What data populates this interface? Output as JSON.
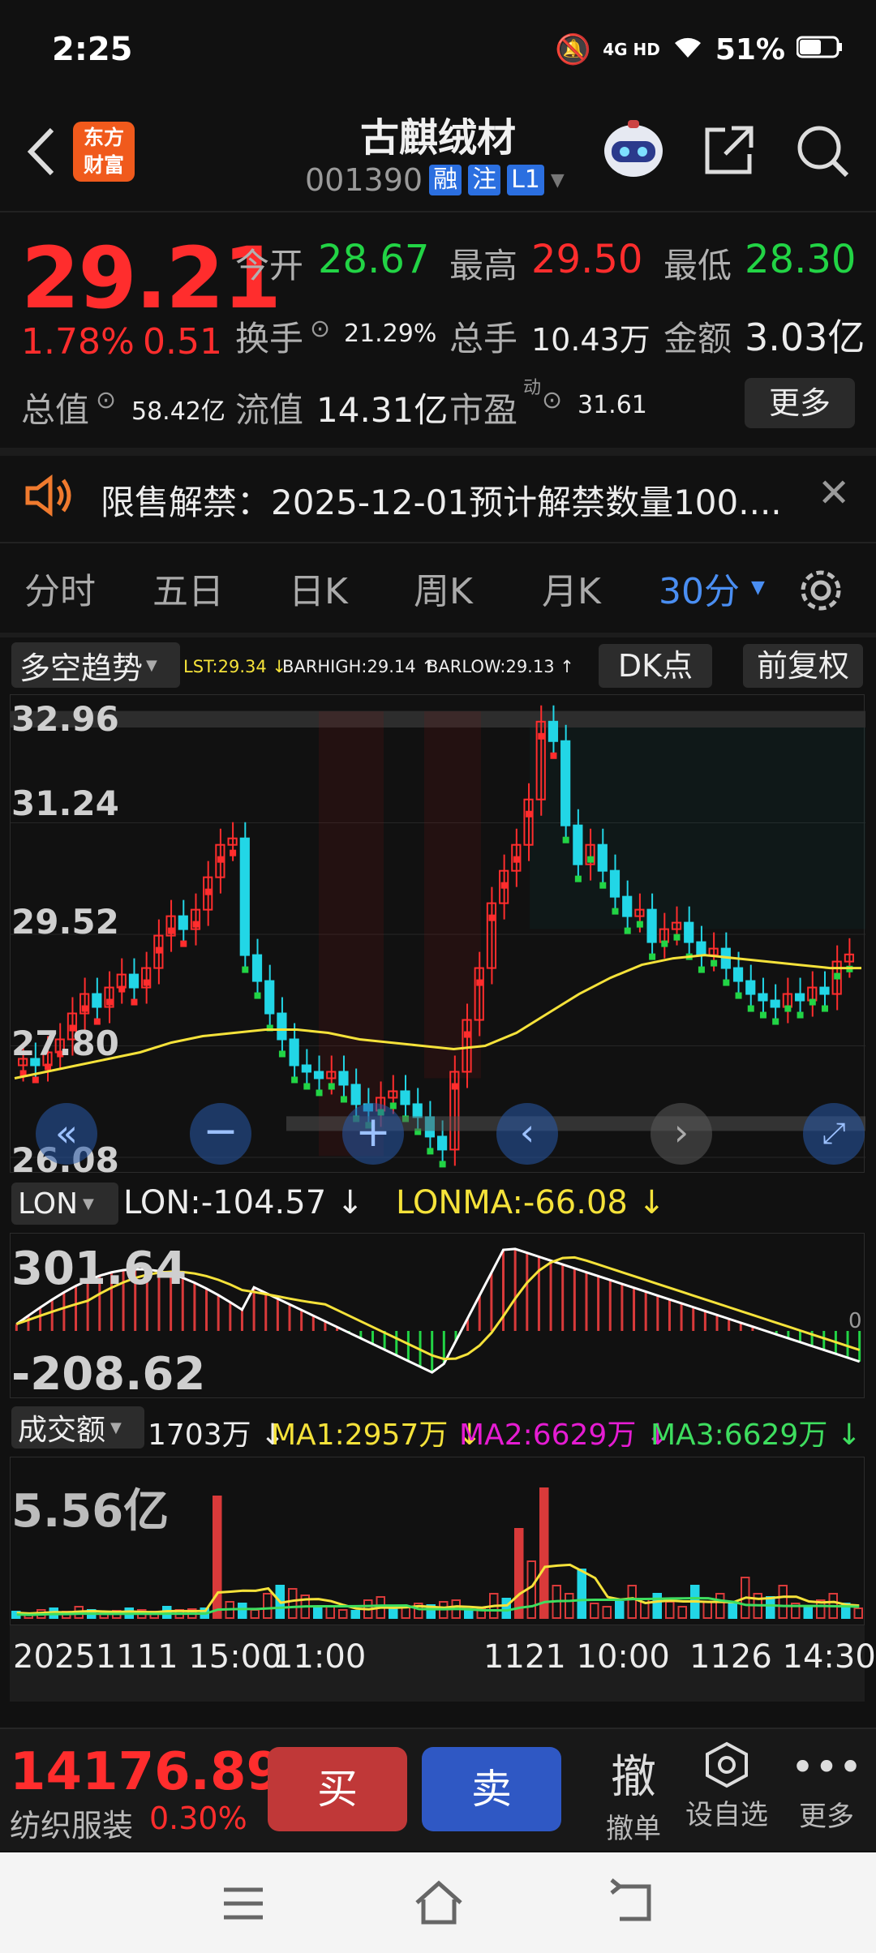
{
  "status_bar": {
    "time": "2:25",
    "network": "4G HD",
    "battery": "51%"
  },
  "header": {
    "title": "古麒绒材",
    "code": "001390",
    "tags": [
      "融",
      "注",
      "L1"
    ],
    "logo": "东方\n财富"
  },
  "quote": {
    "price": "29.21",
    "change_pct": "1.78%",
    "change": "0.51",
    "open_label": "今开",
    "open": "28.67",
    "high_label": "最高",
    "high": "29.50",
    "low_label": "最低",
    "low": "28.30",
    "turnover_label": "换手",
    "turnover": "21.29%",
    "volume_label": "总手",
    "volume": "10.43万",
    "amount_label": "金额",
    "amount": "3.03亿",
    "mktcap_label": "总值",
    "mktcap": "58.42亿",
    "float_label": "流值",
    "float": "14.31亿",
    "pe_label": "市盈",
    "pe_sup": "动",
    "pe": "31.61",
    "more": "更多"
  },
  "notice": {
    "text": "限售解禁：2025-12-01预计解禁数量100...."
  },
  "tabs": [
    "分时",
    "五日",
    "日K",
    "周K",
    "月K",
    "30分"
  ],
  "chart_toolbar": {
    "indicator": "多空趋势",
    "lst": "LST:29.34 ↓",
    "barhigh": "BARHIGH:29.14 ↑",
    "barlow": "BARLOW:29.13 ↑",
    "dk": "DK点",
    "fq": "前复权"
  },
  "price_axis": [
    "32.96",
    "31.24",
    "29.52",
    "27.80",
    "26.08"
  ],
  "lon": {
    "name": "LON",
    "lon": "LON:-104.57 ↓",
    "lonma": "LONMA:-66.08 ↓",
    "top": "301.64",
    "bottom": "-208.62",
    "zero": "0"
  },
  "vol": {
    "name": "成交额",
    "cur": "1703万 ↓",
    "ma1": "MA1:2957万 ↓",
    "ma2": "MA2:6629万 ↓",
    "ma3": "MA3:6629万 ↓",
    "top": "5.56亿"
  },
  "xaxis": [
    "20251111 15:00",
    "11:00",
    "1121 10:00",
    "1126 14:30"
  ],
  "bottom": {
    "index_value": "14176.89",
    "index_name": "纺织服装",
    "index_pct": "0.30%",
    "buy": "买",
    "sell": "卖",
    "cancel_icon_text": "撤",
    "cancel": "撤单",
    "watch": "设自选",
    "more": "更多"
  },
  "chart_data": {
    "type": "candlestick",
    "note_colors": {
      "up": "#ff2d2d",
      "down": "#22d6e6",
      "ma": "#f5e23a"
    },
    "y_ticks": [
      32.96,
      31.24,
      29.52,
      27.8,
      26.08
    ],
    "ylim": [
      26.08,
      32.96
    ],
    "x_ticks": [
      "20251111 15:00",
      "11:00",
      "1121 10:00",
      "1126 14:30"
    ],
    "close_series": [
      27.6,
      27.5,
      27.7,
      27.9,
      28.3,
      28.6,
      28.4,
      28.7,
      28.9,
      28.7,
      29.0,
      29.5,
      29.8,
      29.6,
      29.9,
      30.4,
      30.9,
      31.0,
      29.2,
      28.8,
      28.3,
      27.9,
      27.5,
      27.4,
      27.3,
      27.4,
      27.2,
      26.9,
      26.8,
      27.0,
      27.1,
      26.9,
      26.7,
      26.4,
      26.2,
      27.4,
      28.2,
      29.0,
      30.0,
      30.5,
      30.9,
      31.6,
      32.8,
      32.5,
      31.2,
      30.6,
      30.9,
      30.5,
      30.1,
      29.8,
      29.9,
      29.4,
      29.6,
      29.7,
      29.4,
      29.2,
      29.3,
      29.0,
      28.8,
      28.6,
      28.5,
      28.4,
      28.6,
      28.5,
      28.7,
      28.6,
      29.1,
      29.21
    ],
    "ma_series": [
      27.3,
      27.4,
      27.5,
      27.6,
      27.7,
      27.85,
      27.95,
      28.0,
      28.05,
      28.05,
      28.0,
      27.9,
      27.85,
      27.8,
      27.75,
      27.8,
      28.0,
      28.3,
      28.6,
      28.85,
      29.05,
      29.15,
      29.2,
      29.15,
      29.1,
      29.05,
      29.0,
      29.0
    ]
  }
}
